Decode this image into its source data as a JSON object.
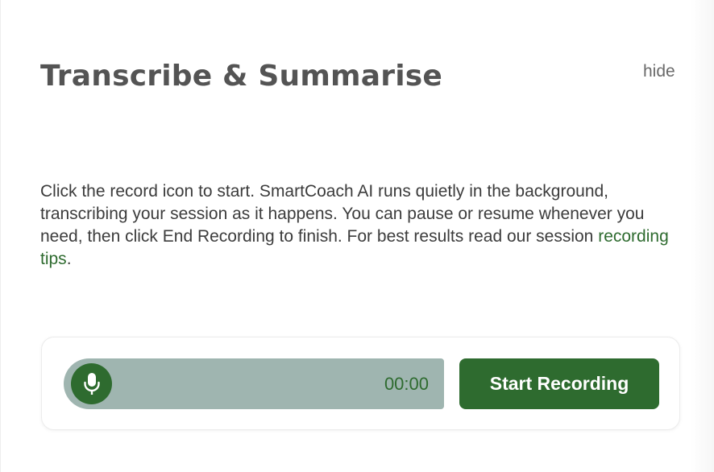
{
  "header": {
    "title": "Transcribe & Summarise",
    "hide_label": "hide"
  },
  "description": {
    "text_before_link": "Click the record icon to start. SmartCoach AI runs quietly in the background, transcribing your session as it happens. You can pause or resume whenever you need, then click End Recording to finish. For best results read our session ",
    "link_text": "recording tips",
    "text_after_link": "."
  },
  "recorder": {
    "mic_icon": "microphone-icon",
    "timer": "00:00",
    "start_button_label": "Start Recording"
  },
  "colors": {
    "accent_green": "#2e6b2f",
    "track_gray_green": "#9fb5b0",
    "title_gray": "#545454",
    "text_gray": "#3c3c3c"
  }
}
